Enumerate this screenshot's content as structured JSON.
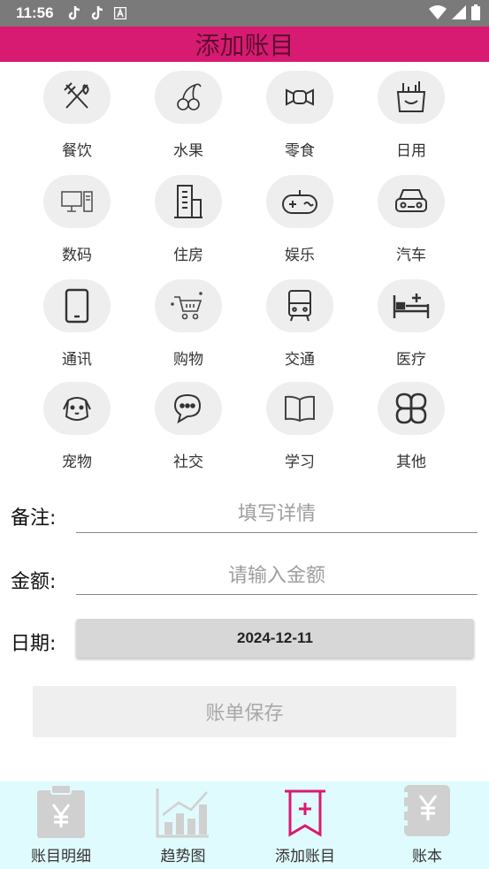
{
  "status_bar": {
    "time": "11:56",
    "left_icons": [
      "tiktok-icon",
      "tiktok-icon",
      "text-a-icon"
    ],
    "right_icons": [
      "wifi-icon",
      "signal-icon",
      "battery-icon"
    ]
  },
  "header": {
    "title": "添加账目",
    "color": "#d81b72"
  },
  "categories": [
    {
      "label": "餐饮",
      "icon": "utensils-icon"
    },
    {
      "label": "水果",
      "icon": "cherry-icon"
    },
    {
      "label": "零食",
      "icon": "candy-icon"
    },
    {
      "label": "日用",
      "icon": "shopping-bag-icon"
    },
    {
      "label": "数码",
      "icon": "computer-icon"
    },
    {
      "label": "住房",
      "icon": "building-icon"
    },
    {
      "label": "娱乐",
      "icon": "gamepad-icon"
    },
    {
      "label": "汽车",
      "icon": "car-icon"
    },
    {
      "label": "通讯",
      "icon": "phone-icon"
    },
    {
      "label": "购物",
      "icon": "cart-icon"
    },
    {
      "label": "交通",
      "icon": "bus-icon"
    },
    {
      "label": "医疗",
      "icon": "hospital-bed-icon"
    },
    {
      "label": "宠物",
      "icon": "dog-icon"
    },
    {
      "label": "社交",
      "icon": "chat-icon"
    },
    {
      "label": "学习",
      "icon": "book-icon"
    },
    {
      "label": "其他",
      "icon": "clover-icon"
    }
  ],
  "form": {
    "note_label": "备注:",
    "note_placeholder": "填写详情",
    "amount_label": "金额:",
    "amount_placeholder": "请输入金额",
    "date_label": "日期:",
    "date_value": "2024-12-11",
    "save_label": "账单保存"
  },
  "bottom_nav": [
    {
      "label": "账目明细",
      "icon": "clipboard-yen-icon",
      "active": false
    },
    {
      "label": "趋势图",
      "icon": "bar-chart-icon",
      "active": false
    },
    {
      "label": "添加账目",
      "icon": "add-bill-icon",
      "active": true
    },
    {
      "label": "账本",
      "icon": "ledger-yen-icon",
      "active": false
    }
  ],
  "colors": {
    "accent": "#d81b72",
    "nav_bg": "#e0fbfd",
    "inactive_icon": "#d0d0d0"
  }
}
